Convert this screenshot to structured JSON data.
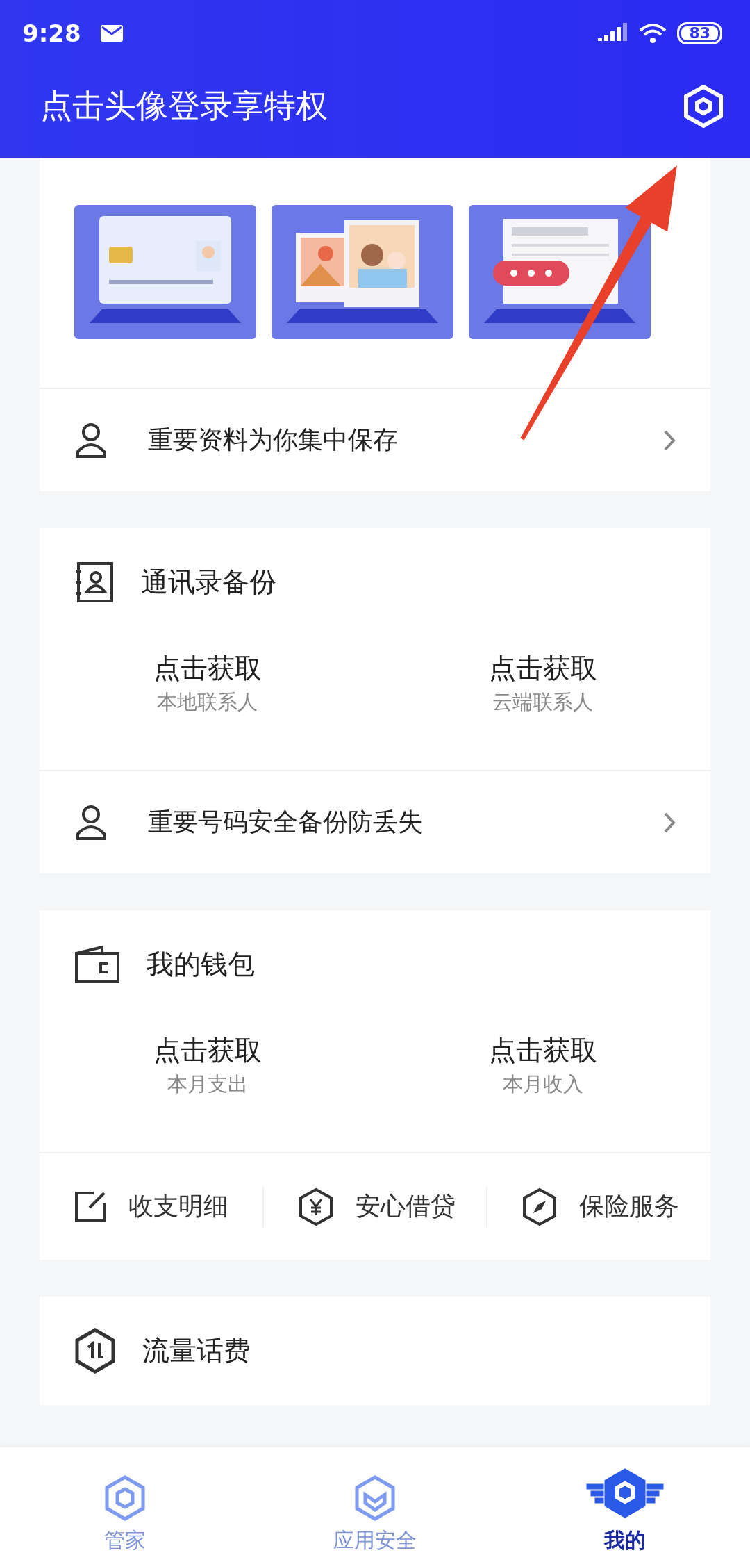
{
  "status_bar": {
    "time": "9:28",
    "battery": "83"
  },
  "header": {
    "title": "点击头像登录享特权"
  },
  "cards": [
    {
      "kind": "gallery",
      "link": "重要资料为你集中保存"
    },
    {
      "kind": "stats",
      "title": "通讯录备份",
      "stats": [
        {
          "value": "点击获取",
          "label": "本地联系人"
        },
        {
          "value": "点击获取",
          "label": "云端联系人"
        }
      ],
      "link": "重要号码安全备份防丢失"
    },
    {
      "kind": "stats",
      "title": "我的钱包",
      "stats": [
        {
          "value": "点击获取",
          "label": "本月支出"
        },
        {
          "value": "点击获取",
          "label": "本月收入"
        }
      ],
      "actions": [
        {
          "label": "收支明细"
        },
        {
          "label": "安心借贷"
        },
        {
          "label": "保险服务"
        }
      ]
    },
    {
      "kind": "stats",
      "title": "流量话费"
    }
  ],
  "tabs": [
    {
      "label": "管家",
      "selected": false
    },
    {
      "label": "应用安全",
      "selected": false
    },
    {
      "label": "我的",
      "selected": true
    }
  ]
}
